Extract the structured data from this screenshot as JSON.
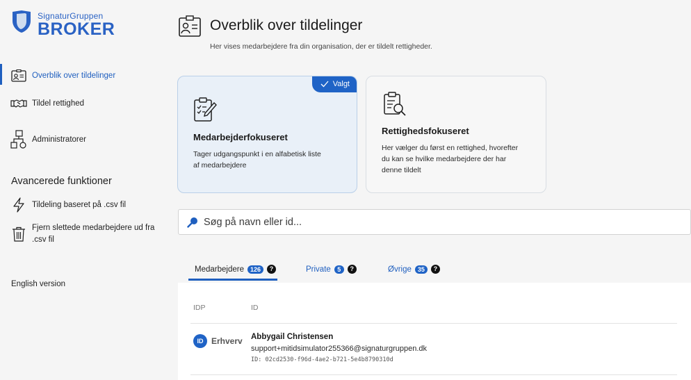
{
  "brand": {
    "top": "SignaturGruppen",
    "main": "BROKER",
    "accent_color": "#2a62c4"
  },
  "sidebar": {
    "items": [
      {
        "label": "Overblik over tildelinger",
        "icon": "id-card-icon",
        "active": true
      },
      {
        "label": "Tildel rettighed",
        "icon": "handshake-icon",
        "active": false
      },
      {
        "label": "Administratorer",
        "icon": "org-chart-icon",
        "active": false
      }
    ],
    "advanced_heading": "Avancerede funktioner",
    "advanced_items": [
      {
        "label": "Tildeling baseret på .csv fil",
        "icon": "lightning-icon"
      },
      {
        "label_line1": "Fjern slettede medarbejdere ud fra",
        "label_line2": ".csv fil",
        "icon": "trash-icon"
      }
    ],
    "language_link": "English version"
  },
  "header": {
    "title": "Overblik over tildelinger",
    "subtitle": "Her vises medarbejdere fra din organisation, der er tildelt rettigheder.",
    "icon": "id-card-icon"
  },
  "cards": [
    {
      "title": "Medarbejderfokuseret",
      "desc_line1": "Tager udgangspunkt i en alfabetisk liste",
      "desc_line2": "af medarbejdere",
      "icon": "clipboard-edit-icon",
      "selected": true,
      "selected_label": "Valgt"
    },
    {
      "title": "Rettighedsfokuseret",
      "desc_line1": "Her vælger du først en rettighed, hvorefter",
      "desc_line2": "du kan se hvilke medarbejdere der har",
      "desc_line3": "denne tildelt",
      "icon": "clipboard-search-icon",
      "selected": false
    }
  ],
  "search": {
    "placeholder": "Søg på navn eller id..."
  },
  "tabs": [
    {
      "label": "Medarbejdere",
      "count": "126",
      "active": true
    },
    {
      "label": "Private",
      "count": "5",
      "active": false
    },
    {
      "label": "Øvrige",
      "count": "35",
      "active": false
    }
  ],
  "help_glyph": "?",
  "table": {
    "columns": [
      "IDP",
      "ID"
    ],
    "rows": [
      {
        "idp": "Erhverv",
        "idp_avatar_text": "ID",
        "name": "Abbygail Christensen",
        "email": "support+mitidsimulator255366@signaturgruppen.dk",
        "id_text": "ID: 02cd2530-f96d-4ae2-b721-5e4b8790310d"
      }
    ]
  },
  "colors": {
    "primary": "#1f63c6",
    "selected_card_bg": "#e9f0f8",
    "background": "#f5f5f5"
  }
}
